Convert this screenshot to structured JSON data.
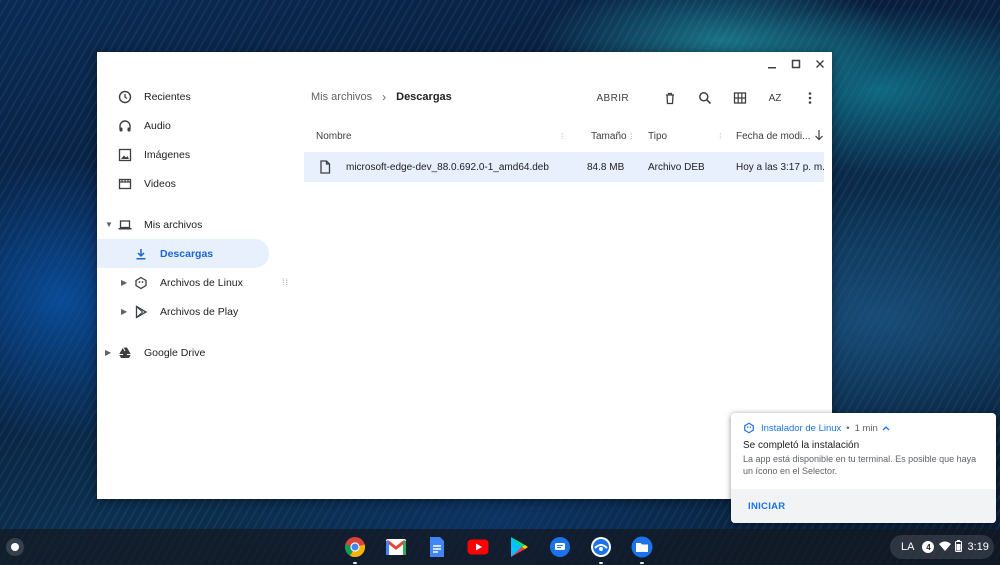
{
  "sidebar": {
    "items": [
      {
        "label": "Recientes",
        "icon": "clock-icon"
      },
      {
        "label": "Audio",
        "icon": "headphones-icon"
      },
      {
        "label": "Imágenes",
        "icon": "image-icon"
      },
      {
        "label": "Videos",
        "icon": "film-icon"
      },
      {
        "label": "Mis archivos",
        "icon": "laptop-icon"
      },
      {
        "label": "Descargas",
        "icon": "download-icon"
      },
      {
        "label": "Archivos de Linux",
        "icon": "linux-icon"
      },
      {
        "label": "Archivos de Play",
        "icon": "play-store-icon"
      },
      {
        "label": "Google Drive",
        "icon": "drive-icon"
      }
    ]
  },
  "breadcrumb": {
    "root": "Mis archivos",
    "current": "Descargas"
  },
  "toolbar": {
    "open_label": "ABRIR",
    "sort_label": "AZ"
  },
  "table": {
    "columns": {
      "name": "Nombre",
      "size": "Tamaño",
      "type": "Tipo",
      "date": "Fecha de modi..."
    },
    "rows": [
      {
        "name": "microsoft-edge-dev_88.0.692.0-1_amd64.deb",
        "size": "84.8 MB",
        "type": "Archivo DEB",
        "date": "Hoy a las 3:17 p. m."
      }
    ]
  },
  "notification": {
    "app": "Instalador de Linux",
    "time": "1 min",
    "title": "Se completó la instalación",
    "message": "La app está disponible en tu terminal. Es posible que haya un ícono en el Selector.",
    "action": "INICIAR"
  },
  "tray": {
    "lang": "LA",
    "badge": "4",
    "time": "3:19"
  },
  "colors": {
    "accent": "#1a73e8",
    "selected_bg": "#e8f0fe",
    "selected_text": "#1967d2"
  }
}
